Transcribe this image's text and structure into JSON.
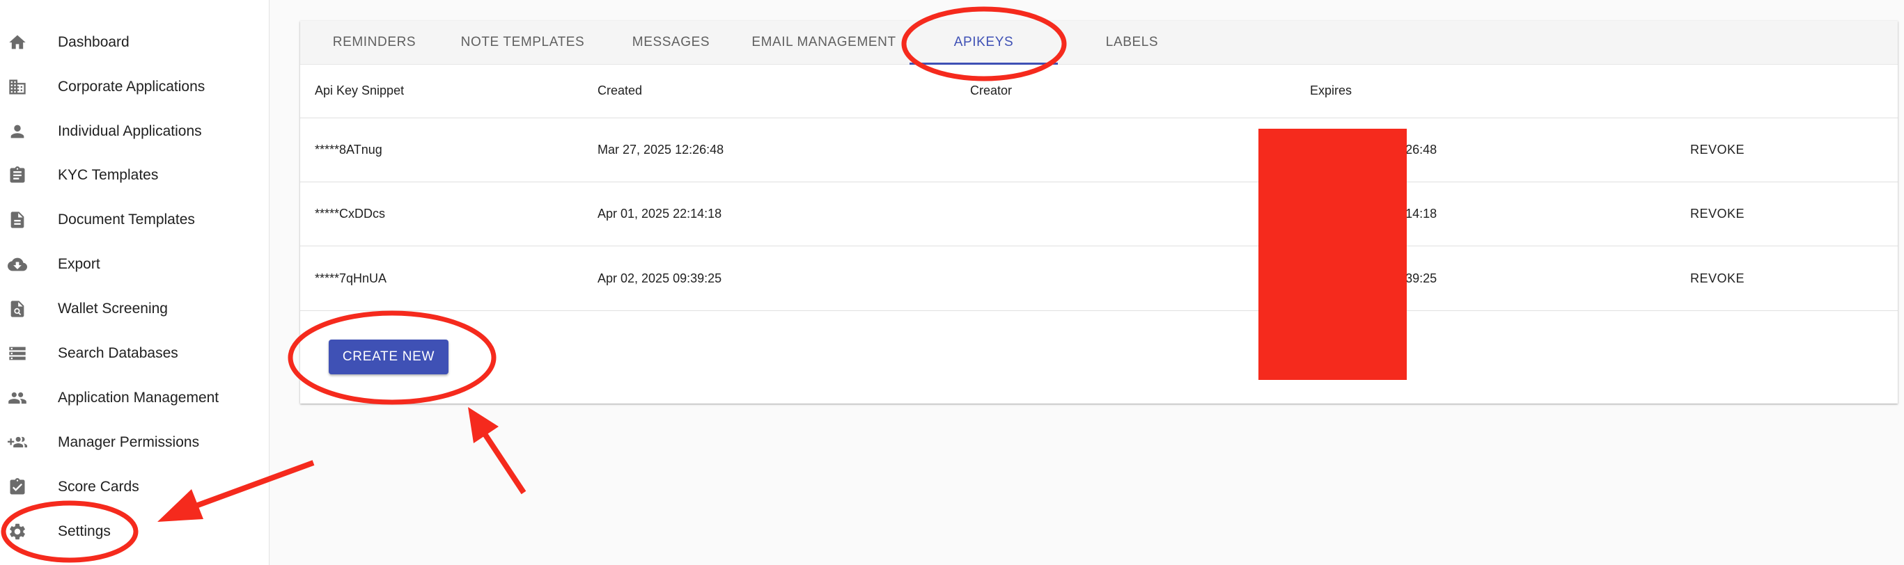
{
  "sidebar": {
    "items": [
      {
        "label": "Dashboard",
        "icon": "home-icon"
      },
      {
        "label": "Corporate Applications",
        "icon": "building-icon"
      },
      {
        "label": "Individual Applications",
        "icon": "person-icon"
      },
      {
        "label": "KYC Templates",
        "icon": "clipboard-icon"
      },
      {
        "label": "Document Templates",
        "icon": "document-icon"
      },
      {
        "label": "Export",
        "icon": "cloud-download-icon"
      },
      {
        "label": "Wallet Screening",
        "icon": "search-document-icon"
      },
      {
        "label": "Search Databases",
        "icon": "storage-icon"
      },
      {
        "label": "Application Management",
        "icon": "people-icon"
      },
      {
        "label": "Manager Permissions",
        "icon": "group-add-icon"
      },
      {
        "label": "Score Cards",
        "icon": "assignment-check-icon"
      },
      {
        "label": "Settings",
        "icon": "gear-icon"
      }
    ]
  },
  "tabs": [
    {
      "label": "Reminders",
      "active": false
    },
    {
      "label": "Note Templates",
      "active": false
    },
    {
      "label": "Messages",
      "active": false
    },
    {
      "label": "Email Management",
      "active": false
    },
    {
      "label": "Apikeys",
      "active": true
    },
    {
      "label": "Labels",
      "active": false
    }
  ],
  "table": {
    "headers": [
      "Api Key Snippet",
      "Created",
      "Creator",
      "Expires"
    ],
    "rows": [
      {
        "snippet": "*****8ATnug",
        "created": "Mar 27, 2025 12:26:48",
        "creator": "",
        "expires": "Aug 24, 2025 12:26:48",
        "action": "REVOKE"
      },
      {
        "snippet": "*****CxDDcs",
        "created": "Apr 01, 2025 22:14:18",
        "creator": "",
        "expires": "Aug 29, 2025 22:14:18",
        "action": "REVOKE"
      },
      {
        "snippet": "*****7qHnUA",
        "created": "Apr 02, 2025 09:39:25",
        "creator": "",
        "expires": "Aug 30, 2025 09:39:25",
        "action": "REVOKE"
      }
    ]
  },
  "create_button": {
    "label": "Create New"
  },
  "colors": {
    "accent": "#3f51b5",
    "annotation_red": "#f52a1d",
    "sidebar_icon": "#6b6b6b"
  }
}
